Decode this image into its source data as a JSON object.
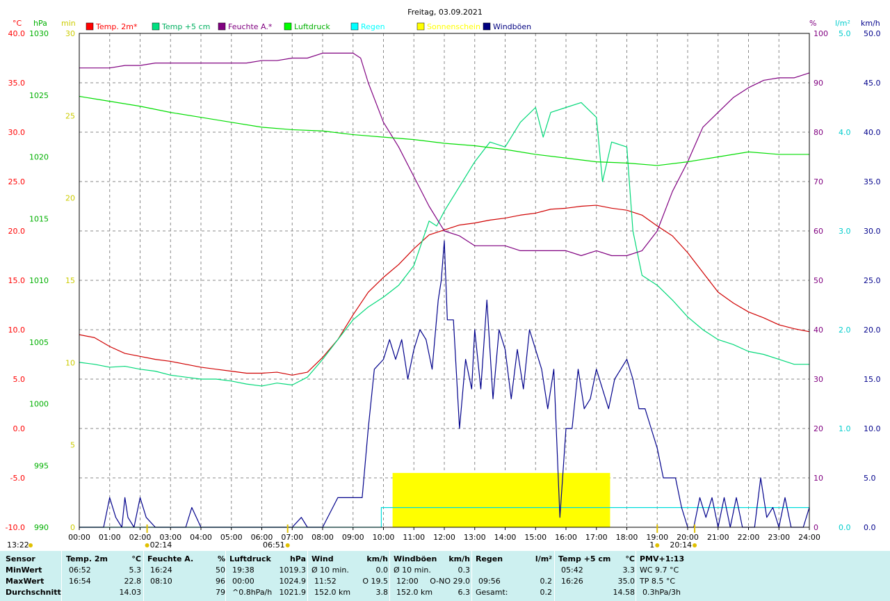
{
  "title": "Freitag, 03.09.2021",
  "footer_left": "13:22",
  "axis_units": {
    "temp": "°C",
    "pressure": "hPa",
    "minutes": "min",
    "humidity": "%",
    "rain": "l/m²",
    "wind": "km/h"
  },
  "chart_data": {
    "type": "line",
    "x_ticks": [
      "00:00",
      "01:00",
      "02:00",
      "03:00",
      "04:00",
      "05:00",
      "06:00",
      "07:00",
      "08:00",
      "09:00",
      "10:00",
      "11:00",
      "12:00",
      "13:00",
      "14:00",
      "15:00",
      "16:00",
      "17:00",
      "18:00",
      "19:00",
      "20:00",
      "21:00",
      "22:00",
      "23:00",
      "24:00"
    ],
    "xlim": [
      0,
      24
    ],
    "axes": {
      "temp": {
        "ticks": [
          "40.0",
          "35.0",
          "30.0",
          "25.0",
          "20.0",
          "15.0",
          "10.0",
          "5.0",
          "0.0",
          "-5.0",
          "-10.0"
        ],
        "ylim": [
          -10,
          40
        ],
        "color": "#ff0000"
      },
      "pressure": {
        "ticks": [
          "1030",
          "1025",
          "1020",
          "1015",
          "1010",
          "1005",
          "1000",
          "995",
          "990"
        ],
        "ylim": [
          990,
          1030
        ],
        "color": "#00b000"
      },
      "minutes": {
        "ticks": [
          "30",
          "25",
          "20",
          "15",
          "10",
          "5",
          "0"
        ],
        "ylim": [
          0,
          30
        ],
        "color": "#cccc00"
      },
      "humidity": {
        "ticks": [
          "100",
          "90",
          "80",
          "70",
          "60",
          "50",
          "40",
          "30",
          "20",
          "10",
          "0"
        ],
        "ylim": [
          0,
          100
        ],
        "color": "#800080"
      },
      "rain": {
        "ticks": [
          "5.0",
          "4.0",
          "3.0",
          "2.0",
          "1.0",
          "0.0"
        ],
        "ylim": [
          0,
          5
        ],
        "color": "#00cccc"
      },
      "wind": {
        "ticks": [
          "50.0",
          "45.0",
          "40.0",
          "35.0",
          "30.0",
          "25.0",
          "20.0",
          "15.0",
          "10.0",
          "5.0",
          "0.0"
        ],
        "ylim": [
          0,
          50
        ],
        "color": "#00008b"
      }
    },
    "legend": [
      {
        "label": "Temp. 2m*",
        "color": "#ff0000"
      },
      {
        "label": "Temp +5 cm",
        "color": "#00e080"
      },
      {
        "label": "Feuchte A.*",
        "color": "#800080"
      },
      {
        "label": "Luftdruck",
        "color": "#00ff00"
      },
      {
        "label": "Regen",
        "color": "#00ffff"
      },
      {
        "label": "Sonnenschein",
        "color": "#ffff00"
      },
      {
        "label": "Windböen",
        "color": "#000080"
      }
    ],
    "series": [
      {
        "name": "Temp. 2m*",
        "axis": "temp",
        "color": "#d00000",
        "x": [
          0,
          0.5,
          1,
          1.5,
          2,
          2.5,
          3,
          3.5,
          4,
          4.5,
          5,
          5.5,
          6,
          6.5,
          7,
          7.5,
          8,
          8.5,
          9,
          9.5,
          10,
          10.5,
          11,
          11.5,
          12,
          12.5,
          13,
          13.5,
          14,
          14.5,
          15,
          15.5,
          16,
          16.5,
          17,
          17.5,
          18,
          18.5,
          19,
          19.5,
          20,
          20.5,
          21,
          21.5,
          22,
          22.5,
          23,
          23.5,
          24
        ],
        "y": [
          9.5,
          9.2,
          8.3,
          7.6,
          7.3,
          7.0,
          6.8,
          6.5,
          6.2,
          6.0,
          5.8,
          5.6,
          5.6,
          5.7,
          5.4,
          5.7,
          7.2,
          9.0,
          11.5,
          13.8,
          15.3,
          16.6,
          18.2,
          19.6,
          20.1,
          20.6,
          20.8,
          21.1,
          21.3,
          21.6,
          21.8,
          22.2,
          22.3,
          22.5,
          22.6,
          22.3,
          22.1,
          21.6,
          20.5,
          19.5,
          17.8,
          15.8,
          13.8,
          12.7,
          11.8,
          11.2,
          10.5,
          10.1,
          9.8
        ]
      },
      {
        "name": "Temp +5 cm",
        "axis": "temp",
        "color": "#00d878",
        "x": [
          0,
          0.5,
          1,
          1.5,
          2,
          2.5,
          3,
          3.5,
          4,
          4.5,
          5,
          5.5,
          6,
          6.5,
          7,
          7.5,
          8,
          8.5,
          9,
          9.5,
          10,
          10.5,
          11,
          11.5,
          11.75,
          12,
          12.5,
          13,
          13.5,
          14,
          14.5,
          15,
          15.25,
          15.5,
          16,
          16.5,
          17,
          17.2,
          17.5,
          18,
          18.2,
          18.5,
          19,
          19.5,
          20,
          20.5,
          21,
          21.5,
          22,
          22.5,
          23,
          23.5,
          24
        ],
        "y": [
          6.7,
          6.5,
          6.2,
          6.3,
          6.0,
          5.8,
          5.4,
          5.2,
          5.0,
          5.0,
          4.8,
          4.5,
          4.3,
          4.6,
          4.4,
          5.2,
          7.0,
          9.0,
          11.0,
          12.3,
          13.3,
          14.5,
          16.5,
          21.0,
          20.5,
          22.0,
          24.5,
          27.0,
          29.0,
          28.5,
          31.0,
          32.5,
          29.5,
          32.0,
          32.5,
          33.0,
          31.5,
          25.0,
          29.0,
          28.5,
          20.0,
          15.5,
          14.5,
          13.0,
          11.3,
          10.0,
          9.0,
          8.5,
          7.8,
          7.5,
          7.0,
          6.5,
          6.5
        ]
      },
      {
        "name": "Feuchte A.*",
        "axis": "humidity",
        "color": "#800080",
        "x": [
          0,
          0.5,
          1,
          1.5,
          2,
          2.5,
          3,
          3.5,
          4,
          4.5,
          5,
          5.5,
          6,
          6.5,
          7,
          7.5,
          8,
          8.5,
          9,
          9.25,
          9.5,
          10,
          10.5,
          11,
          11.5,
          12,
          12.5,
          13,
          13.5,
          14,
          14.5,
          15,
          15.5,
          16,
          16.5,
          17,
          17.5,
          18,
          18.5,
          19,
          19.5,
          20,
          20.5,
          21,
          21.5,
          22,
          22.5,
          23,
          23.5,
          24
        ],
        "y": [
          93,
          93,
          93,
          93.5,
          93.5,
          94,
          94,
          94,
          94,
          94,
          94,
          94,
          94.5,
          94.5,
          95,
          95,
          96,
          96,
          96,
          95,
          90,
          82,
          77,
          71,
          65,
          60,
          59,
          57,
          57,
          57,
          56,
          56,
          56,
          56,
          55,
          56,
          55,
          55,
          56,
          60,
          68,
          74,
          81,
          84,
          87,
          89,
          90.5,
          91,
          91,
          92
        ]
      },
      {
        "name": "Luftdruck",
        "axis": "pressure",
        "color": "#00dd00",
        "x": [
          0,
          1,
          2,
          3,
          4,
          5,
          6,
          7,
          8,
          9,
          10,
          11,
          12,
          13,
          14,
          15,
          16,
          17,
          18,
          19,
          20,
          21,
          22,
          23,
          24
        ],
        "y": [
          1024.9,
          1024.5,
          1024.1,
          1023.6,
          1023.2,
          1022.8,
          1022.4,
          1022.2,
          1022.1,
          1021.8,
          1021.6,
          1021.4,
          1021.1,
          1020.9,
          1020.6,
          1020.2,
          1019.9,
          1019.6,
          1019.5,
          1019.3,
          1019.6,
          1020.0,
          1020.4,
          1020.2,
          1020.2
        ]
      },
      {
        "name": "Windböen",
        "axis": "wind",
        "color": "#00008b",
        "x": [
          0,
          0.5,
          0.8,
          1,
          1.2,
          1.4,
          1.5,
          1.6,
          1.8,
          2,
          2.2,
          2.5,
          3,
          3.5,
          3.7,
          4,
          5,
          6,
          7,
          7.3,
          7.5,
          8,
          8.5,
          9,
          9.3,
          9.5,
          9.7,
          10,
          10.2,
          10.4,
          10.6,
          10.8,
          11,
          11.2,
          11.4,
          11.6,
          11.8,
          11.9,
          12,
          12.1,
          12.3,
          12.5,
          12.7,
          12.9,
          13,
          13.2,
          13.4,
          13.6,
          13.8,
          14,
          14.2,
          14.4,
          14.6,
          14.8,
          15,
          15.2,
          15.4,
          15.6,
          15.8,
          16,
          16.2,
          16.4,
          16.6,
          16.8,
          17,
          17.2,
          17.4,
          17.6,
          17.8,
          18,
          18.2,
          18.4,
          18.6,
          18.8,
          19,
          19.2,
          19.4,
          19.6,
          19.8,
          20,
          20.2,
          20.4,
          20.6,
          20.8,
          21,
          21.2,
          21.4,
          21.6,
          21.8,
          22,
          22.2,
          22.4,
          22.6,
          22.8,
          23,
          23.2,
          23.4,
          23.6,
          23.8,
          24
        ],
        "y": [
          0,
          0,
          0,
          3,
          1,
          0,
          3,
          1,
          0,
          3,
          1,
          0,
          0,
          0,
          2,
          0,
          0,
          0,
          0,
          1,
          0,
          0,
          3,
          3,
          3,
          10,
          16,
          17,
          19,
          17,
          19,
          15,
          18,
          20,
          19,
          16,
          23,
          25,
          29,
          21,
          21,
          10,
          17,
          14,
          20,
          14,
          23,
          13,
          20,
          18,
          13,
          18,
          14,
          20,
          18,
          16,
          12,
          16,
          1,
          10,
          10,
          16,
          12,
          13,
          16,
          14,
          12,
          15,
          16,
          17,
          15,
          12,
          12,
          10,
          8,
          5,
          5,
          5,
          2,
          0,
          0,
          3,
          1,
          3,
          0,
          3,
          0,
          3,
          0,
          0,
          0,
          5,
          1,
          2,
          0,
          3,
          0,
          0,
          0,
          2
        ]
      }
    ],
    "bands": [
      {
        "name": "Sonnenschein",
        "axis": "minutes",
        "x_start": 10.3,
        "x_end": 17.45,
        "y": 3.3,
        "color": "#ffff00"
      }
    ],
    "steps": [
      {
        "name": "Regen",
        "axis": "rain",
        "points": [
          [
            0,
            0
          ],
          [
            9.93,
            0
          ],
          [
            9.93,
            0.2
          ],
          [
            24,
            0.2
          ]
        ],
        "color": "#00dddd"
      }
    ],
    "markers": [
      {
        "x": 2.23,
        "label": "02:14",
        "side": "right"
      },
      {
        "x": 6.85,
        "label": "06:51",
        "side": "left"
      },
      {
        "x": 19.0,
        "label": "1",
        "side": "left"
      },
      {
        "x": 20.23,
        "label": "20:14",
        "side": "left"
      }
    ]
  },
  "table": {
    "row_labels": [
      "Sensor",
      "MinWert",
      "MaxWert",
      "Durchschnitt"
    ],
    "sections": [
      {
        "name": "Temp. 2m",
        "unit": "°C",
        "rows": [
          [
            "06:52",
            "5.3"
          ],
          [
            "16:54",
            "22.8"
          ],
          [
            "",
            "14.03"
          ]
        ]
      },
      {
        "name": "Feuchte A.",
        "unit": "%",
        "rows": [
          [
            "16:24",
            "50"
          ],
          [
            "08:10",
            "96"
          ],
          [
            "",
            "79"
          ]
        ]
      },
      {
        "name": "Luftdruck",
        "unit": "hPa",
        "rows": [
          [
            "19:38",
            "1019.3"
          ],
          [
            "00:00",
            "1024.9"
          ],
          [
            "^0.8hPa/h",
            "1021.9"
          ]
        ]
      },
      {
        "name": "Wind",
        "unit": "km/h",
        "rows": [
          [
            "Ø 10 min.",
            "0.0"
          ],
          [
            "11:52",
            "O 19.5"
          ],
          [
            "152.0 km",
            "3.8"
          ]
        ]
      },
      {
        "name": "Windböen",
        "unit": "km/h",
        "rows": [
          [
            "Ø 10 min.",
            "0.3"
          ],
          [
            "12:00",
            "O-NO 29.0"
          ],
          [
            "152.0 km",
            "6.3"
          ]
        ]
      },
      {
        "name": "Regen",
        "unit": "l/m²",
        "rows": [
          [
            "",
            ""
          ],
          [
            "09:56",
            "0.2"
          ],
          [
            "Gesamt:",
            "0.2"
          ]
        ]
      },
      {
        "name": "Temp +5 cm",
        "unit": "°C",
        "rows": [
          [
            "05:42",
            "3.3"
          ],
          [
            "16:26",
            "35.0"
          ],
          [
            "",
            "14.58"
          ]
        ]
      },
      {
        "name": "PMV+1:13",
        "unit": "",
        "rows": [
          [
            "WC 9.7 °C",
            ""
          ],
          [
            "TP 8.5 °C",
            ""
          ],
          [
            "0.3hPa/3h",
            ""
          ]
        ]
      }
    ]
  }
}
